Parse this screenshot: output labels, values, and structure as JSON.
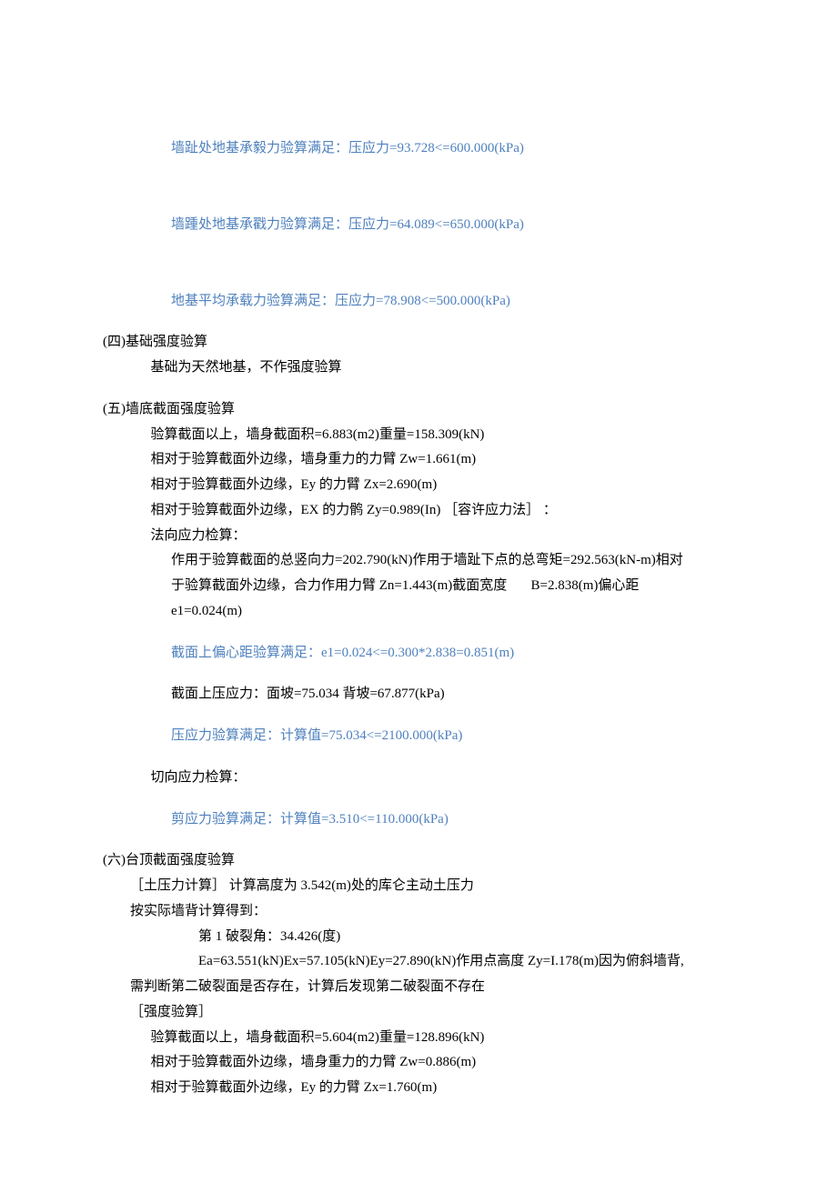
{
  "checks": {
    "toe": "墙趾处地基承毅力验算满足：压应力=93.728<=600.000(kPa)",
    "heel": "墙踵处地基承戳力验算满足：压应力=64.089<=650.000(kPa)",
    "avg": "地基平均承载力验算满足：压应力=78.908<=500.000(kPa)"
  },
  "s4": {
    "title": "(四)基础强度验算",
    "l1": "基础为天然地基，不作强度验算"
  },
  "s5": {
    "title": "(五)墙底截面强度验算",
    "l1": "验算截面以上，墙身截面积=6.883(m2)重量=158.309(kN)",
    "l2": "相对于验算截面外边缘，墙身重力的力臂 Zw=1.661(m)",
    "l3": "相对于验算截面外边缘，Ey 的力臂 Zx=2.690(m)",
    "l4": "相对于验算截面外边缘，EX 的力鹘 Zy=0.989(In) ［容许应力法］ ：",
    "l5": "法向应力检算：",
    "l6a": "作用于验算截面的总竖向力=202.790(kN)作用于墙趾下点的总弯矩=292.563(kN-m)相对",
    "l6b": "于验算截面外边缘，合力作用力臂 Zn=1.443(m)截面宽度       B=2.838(m)偏心距",
    "l6c": "e1=0.024(m)",
    "chk1": "截面上偏心距验算满足：e1=0.024<=0.300*2.838=0.851(m)",
    "l7": "截面上压应力：面坡=75.034 背坡=67.877(kPa)",
    "chk2": "压应力验算满足：计算值=75.034<=2100.000(kPa)",
    "l8": "切向应力检算：",
    "chk3": "剪应力验算满足：计算值=3.510<=110.000(kPa)"
  },
  "s6": {
    "title": "(六)台顶截面强度验算",
    "l1": "［土压力计算］ 计算高度为 3.542(m)处的库仑主动土压力",
    "l2": "按实际墙背计算得到：",
    "l3": "第 1 破裂角：34.426(度)",
    "l4": "Ea=63.551(kN)Ex=57.105(kN)Ey=27.890(kN)作用点高度 Zy=I.178(m)因为俯斜墙背,",
    "l5": "需判断第二破裂面是否存在，计算后发现第二破裂面不存在",
    "l6": "［强度验算］",
    "l7": "验算截面以上，墙身截面积=5.604(m2)重量=128.896(kN)",
    "l8": "相对于验算截面外边缘，墙身重力的力臂 Zw=0.886(m)",
    "l9": "相对于验算截面外边缘，Ey 的力臂 Zx=1.760(m)"
  }
}
